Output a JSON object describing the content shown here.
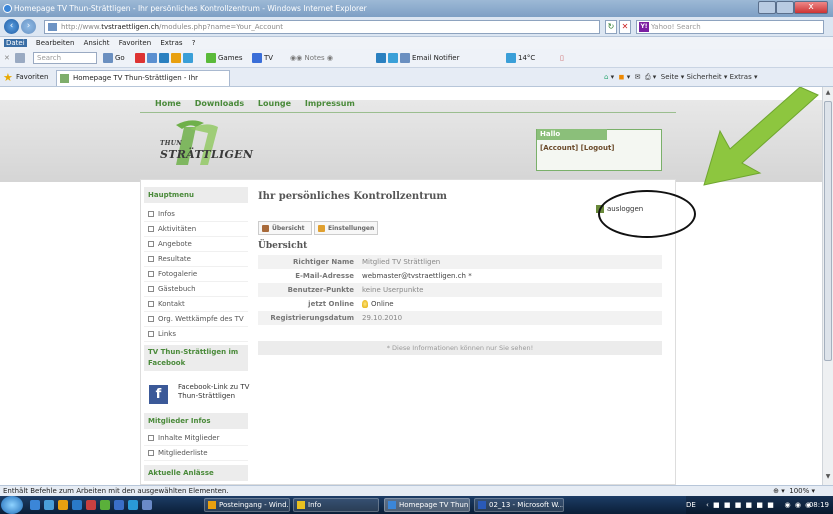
{
  "window": {
    "title": "Homepage TV Thun-Strättligen - Ihr persönliches Kontrollzentrum - Windows Internet Explorer",
    "close_glyph": "x"
  },
  "address_bar": {
    "prefix": "http://www.",
    "domain": "tvstraettligen.ch",
    "path": "/modules.php?name=Your_Account"
  },
  "search_box": {
    "placeholder": "Yahoo! Search",
    "logo": "Y!"
  },
  "menu": [
    "Datei",
    "Bearbeiten",
    "Ansicht",
    "Favoriten",
    "Extras",
    "?"
  ],
  "toolbar": {
    "search_placeholder": "Search",
    "go_label": "Go",
    "games_label": "Games",
    "tv_label": "TV",
    "notes_label": "Notes",
    "email_notifier_label": "Email Notifier",
    "temperature": "14°C"
  },
  "favorites_bar": {
    "favorites_label": "Favoriten",
    "tab_title": "Homepage TV Thun-Strättligen - Ihr persönliches...",
    "right_commands": "Seite ▾  Sicherheit ▾  Extras ▾"
  },
  "site": {
    "nav": [
      "Home",
      "Downloads",
      "Lounge",
      "Impressum"
    ],
    "logo_small": "THUN",
    "logo_big": "STRÄTTLIGEN",
    "hallo": {
      "title": "Hallo",
      "links": "[Account] [Logout]"
    },
    "sidebar": {
      "menu_head": "Hauptmenu",
      "items": [
        "Infos",
        "Aktivitäten",
        "Angebote",
        "Resultate",
        "Fotogalerie",
        "Gästebuch",
        "Kontakt",
        "Org. Wettkämpfe des TV",
        "Links"
      ],
      "facebook_head": "TV Thun-Strättligen im Facebook",
      "facebook_text": "Facebook-Link zu TV Thun-Strättligen",
      "member_head": "Mitglieder Infos",
      "member_items": [
        "Inhalte Mitglieder",
        "Mitgliederliste"
      ],
      "events_head": "Aktuelle Anlässe"
    },
    "main": {
      "title": "Ihr persönliches Kontrollzentrum",
      "logout_label": "ausloggen",
      "tabs": [
        "Übersicht",
        "Einstellungen"
      ],
      "section_title": "Übersicht",
      "rows": [
        {
          "key": "Richtiger Name",
          "value": "Mitglied TV Strättligen"
        },
        {
          "key": "E-Mail-Adresse",
          "value": "webmaster@tvstraettligen.ch *"
        },
        {
          "key": "Benutzer-Punkte",
          "value": "keine Userpunkte"
        },
        {
          "key": "jetzt Online",
          "value": "Online"
        },
        {
          "key": "Registrierungsdatum",
          "value": "29.10.2010"
        }
      ],
      "note": "* Diese Informationen können nur Sie sehen!"
    }
  },
  "statusbar": {
    "text": "Enthält Befehle zum Arbeiten mit den ausgewählten Elementen.",
    "zoom": "100%"
  },
  "taskbar": {
    "tasks": [
      "Posteingang - Wind...",
      "Info",
      "Homepage TV Thun...",
      "02_13 - Microsoft W..."
    ],
    "lang": "DE",
    "clock": "08:19"
  },
  "colors": {
    "accent_green": "#4a8a3a",
    "annotation_arrow": "#8dc63f"
  }
}
